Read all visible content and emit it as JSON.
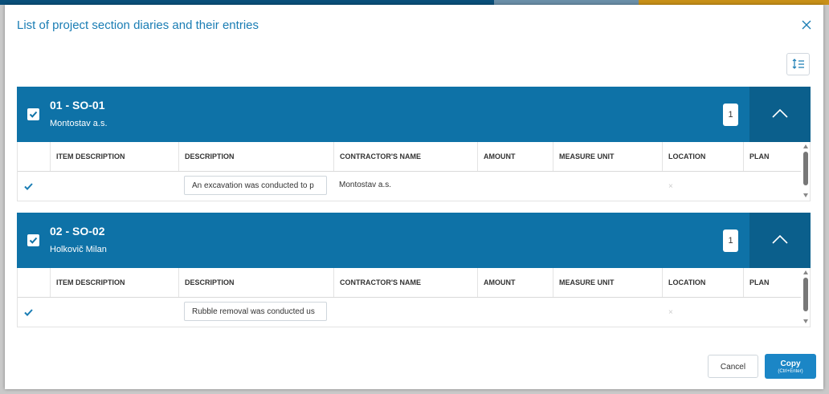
{
  "colors": {
    "accent": "#1a7db4",
    "section_header": "#0e72a7",
    "collapse_button": "#0b5f8c",
    "primary_button": "#1b86c6"
  },
  "modal": {
    "title": "List of project section diaries and their entries",
    "close_icon": "close-icon",
    "sort_icon": "sort-list-icon"
  },
  "columns": [
    "ITEM DESCRIPTION",
    "DESCRIPTION",
    "CONTRACTOR'S NAME",
    "AMOUNT",
    "MEASURE UNIT",
    "LOCATION",
    "PLAN"
  ],
  "sections": [
    {
      "code": "01 - SO-01",
      "contractor": "Montostav a.s.",
      "count": "1",
      "checked": true,
      "rows": [
        {
          "checked": true,
          "item_description": "",
          "description": "An excavation was conducted to p",
          "contractor_name": "Montostav a.s.",
          "amount": "",
          "measure_unit": "",
          "location": "×",
          "plan": ""
        }
      ]
    },
    {
      "code": "02 - SO-02",
      "contractor": "Holkovič Milan",
      "count": "1",
      "checked": true,
      "rows": [
        {
          "checked": true,
          "item_description": "",
          "description": "Rubble removal was conducted us",
          "contractor_name": "",
          "amount": "",
          "measure_unit": "",
          "location": "×",
          "plan": ""
        }
      ]
    }
  ],
  "footer": {
    "cancel_label": "Cancel",
    "copy_label": "Copy",
    "copy_hint": "(Ctrl+Enter)"
  }
}
